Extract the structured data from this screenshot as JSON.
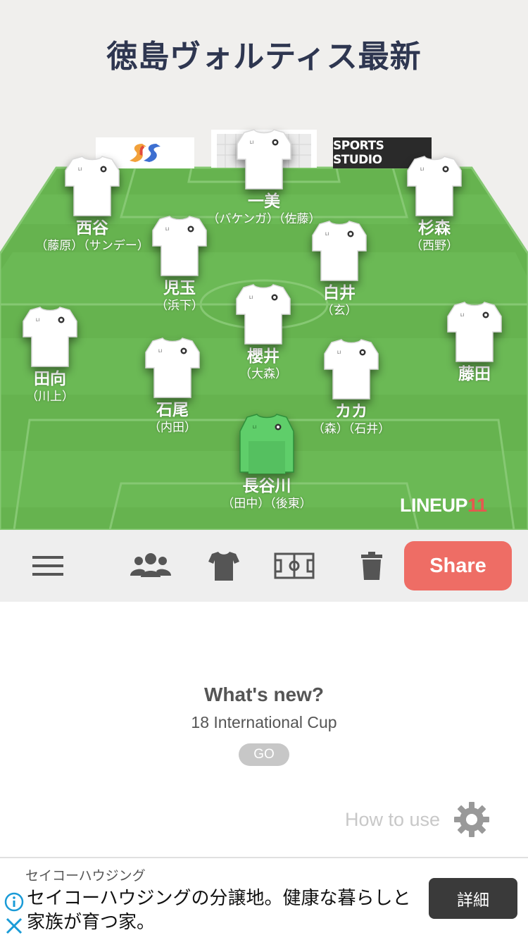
{
  "header": {
    "title": "徳島ヴォルティス最新"
  },
  "sponsors": {
    "right_text": "SPORTS STUDIO"
  },
  "players": [
    {
      "id": "p1",
      "name": "一美",
      "subs": "（バケンガ）（佐藤）"
    },
    {
      "id": "p2",
      "name": "西谷",
      "subs": "（藤原）（サンデー）"
    },
    {
      "id": "p3",
      "name": "杉森",
      "subs": "（西野）"
    },
    {
      "id": "p4",
      "name": "児玉",
      "subs": "（浜下）"
    },
    {
      "id": "p5",
      "name": "白井",
      "subs": "（玄）"
    },
    {
      "id": "p6",
      "name": "田向",
      "subs": "（川上）"
    },
    {
      "id": "p7",
      "name": "櫻井",
      "subs": "（大森）"
    },
    {
      "id": "p8",
      "name": "藤田",
      "subs": ""
    },
    {
      "id": "p9",
      "name": "石尾",
      "subs": "（内田）"
    },
    {
      "id": "p10",
      "name": "カカ",
      "subs": "（森）（石井）"
    },
    {
      "id": "p11",
      "name": "長谷川",
      "subs": "（田中）（後東）"
    }
  ],
  "watermark": {
    "text": "LINEUP",
    "number": "11"
  },
  "toolbar": {
    "items": [
      {
        "icon": "menu-icon"
      },
      {
        "icon": "users-icon"
      },
      {
        "icon": "shirt-icon"
      },
      {
        "icon": "pitch-icon"
      },
      {
        "icon": "trash-icon"
      }
    ],
    "share_label": "Share",
    "share_color": "#ee6d65"
  },
  "whats_new": {
    "title": "What's new?",
    "subtitle": "18 International Cup",
    "go_label": "GO"
  },
  "how_to_use": {
    "label": "How to use",
    "icon": "gear-icon"
  },
  "ad": {
    "advertiser": "セイコーハウジング",
    "text": "セイコーハウジングの分譲地。健康な暮らしと家族が育つ家。",
    "button_label": "詳細",
    "info_icon": "info-icon",
    "close_icon": "close-icon"
  },
  "colors": {
    "pitch": "#66b34f",
    "title": "#2e3650",
    "gk_shirt": "#5fce6a"
  }
}
